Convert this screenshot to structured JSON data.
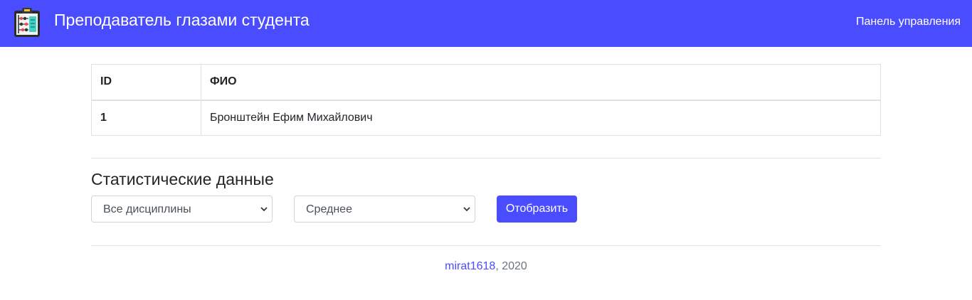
{
  "navbar": {
    "logo_icon": "clipboard-abacus-icon",
    "title": "Преподаватель глазами студента",
    "panel_link": "Панель управления",
    "color": "#4a4cff"
  },
  "table": {
    "headers": [
      "ID",
      "ФИО"
    ],
    "rows": [
      {
        "id": "1",
        "name": "Бронштейн Ефим Михайлович"
      }
    ]
  },
  "stats": {
    "heading": "Статистические данные",
    "discipline_select": {
      "selected": "Все дисциплины"
    },
    "metric_select": {
      "selected": "Среднее"
    },
    "show_button": "Отобразить"
  },
  "footer": {
    "author_link": "mirat1618",
    "suffix": ", 2020"
  }
}
